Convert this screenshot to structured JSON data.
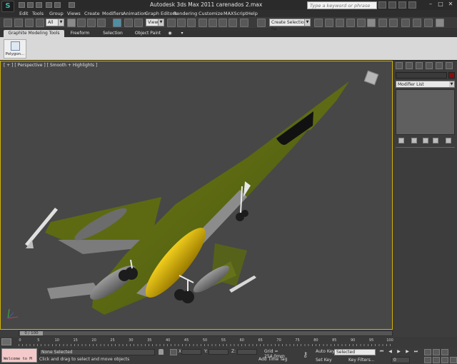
{
  "title": "Autodesk 3ds Max  2011      carenados 2.max",
  "search_placeholder": "Type a keyword or phrase",
  "menu": [
    "Edit",
    "Tools",
    "Group",
    "Views",
    "Create",
    "Modifiers",
    "Animation",
    "Graph Editors",
    "Rendering",
    "Customize",
    "MAXScript",
    "Help"
  ],
  "toolbar": {
    "filter_select": "All",
    "coord_select": "View",
    "named_selection": "Create Selection Se"
  },
  "ribbon": {
    "tabs": [
      "Graphite Modeling Tools",
      "Freeform",
      "Selection",
      "Object Paint"
    ],
    "polygon_button": "Polygon..."
  },
  "viewport": {
    "label": "[ + ] [ Perspective ] [ Smooth + Highlights ]"
  },
  "command_panel": {
    "modifier_list": "Modifier List",
    "object_color": "#8a0c0c"
  },
  "timeslider": {
    "frame_display": "0 / 100"
  },
  "trackbar": {
    "ticks": [
      "0",
      "5",
      "10",
      "15",
      "20",
      "25",
      "30",
      "35",
      "40",
      "45",
      "50",
      "55",
      "60",
      "65",
      "70",
      "75",
      "80",
      "85",
      "90",
      "95",
      "100"
    ]
  },
  "status": {
    "listener_text": "Welcome to M",
    "selection_info": "None Selected",
    "prompt": "Click and drag to select and move objects",
    "x_label": "X:",
    "y_label": "Y:",
    "z_label": "Z:",
    "grid": "Grid = 254,0mm",
    "add_time_tag": "Add Time Tag",
    "auto_key": "Auto Key",
    "set_key": "Set Key",
    "key_mode": "Selected",
    "key_filters": "Key Filters...",
    "current_frame": "0"
  }
}
